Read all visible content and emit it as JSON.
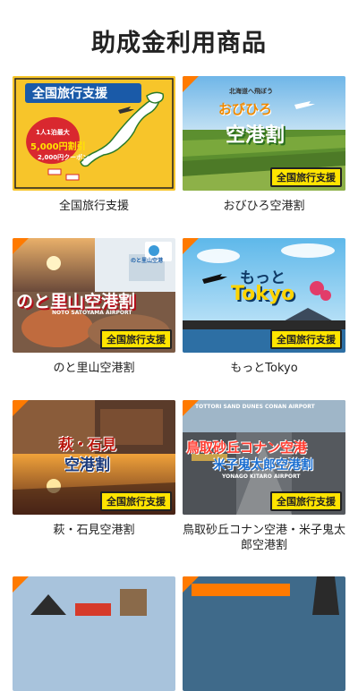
{
  "page": {
    "title": "助成金利用商品"
  },
  "badge_text": "全国旅行支援",
  "products": [
    {
      "caption": "全国旅行支援",
      "overlay_title": "全国旅行支援",
      "promo_line1": "1人1泊最大",
      "promo_line2": "5,000円割引",
      "promo_line3": "2,000円クーポン"
    },
    {
      "caption": "おびひろ空港割",
      "overlay_title": "おびひろ",
      "overlay_sub": "空港割",
      "overlay_top": "北海道へ飛ぼう"
    },
    {
      "caption": "のと里山空港割",
      "overlay_title": "のと里山空港割",
      "overlay_sub": "NOTO SATOYAMA AIRPORT",
      "logo_text": "のと里山空港"
    },
    {
      "caption": "もっとTokyo",
      "overlay_title": "もっと",
      "overlay_sub": "Tokyo"
    },
    {
      "caption": "萩・石見空港割",
      "overlay_title": "萩・石見",
      "overlay_sub": "空港割"
    },
    {
      "caption": "鳥取砂丘コナン空港・米子鬼太郎空港割",
      "overlay_title": "鳥取砂丘コナン空港",
      "overlay_sub": "米子鬼太郎空港割",
      "overlay_top": "TOTTORI SAND DUNES CONAN AIRPORT",
      "overlay_mid": "YONAGO KITARO AIRPORT"
    },
    {
      "caption": "",
      "overlay_title": ""
    },
    {
      "caption": "",
      "overlay_title": "",
      "overlay_top": ""
    }
  ]
}
